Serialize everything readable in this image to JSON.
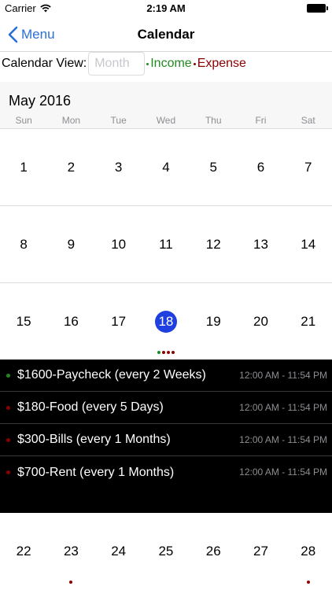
{
  "status_bar": {
    "carrier": "Carrier",
    "time": "2:19 AM"
  },
  "nav": {
    "back_label": "Menu",
    "title": "Calendar"
  },
  "view_row": {
    "label": "Calendar View:",
    "input_value": "",
    "input_placeholder": "Month",
    "income_label": "Income",
    "expense_label": "Expense"
  },
  "colors": {
    "accent": "#2a6fd6",
    "selected": "#1f3fe0",
    "income": "#1f8a1f",
    "expense": "#8b0000"
  },
  "calendar": {
    "month_title": "May 2016",
    "weekdays": [
      "Sun",
      "Mon",
      "Tue",
      "Wed",
      "Thu",
      "Fri",
      "Sat"
    ],
    "weeks": [
      [
        {
          "n": "1"
        },
        {
          "n": "2"
        },
        {
          "n": "3"
        },
        {
          "n": "4"
        },
        {
          "n": "5"
        },
        {
          "n": "6"
        },
        {
          "n": "7"
        }
      ],
      [
        {
          "n": "8"
        },
        {
          "n": "9"
        },
        {
          "n": "10"
        },
        {
          "n": "11"
        },
        {
          "n": "12"
        },
        {
          "n": "13"
        },
        {
          "n": "14"
        }
      ],
      [
        {
          "n": "15"
        },
        {
          "n": "16"
        },
        {
          "n": "17"
        },
        {
          "n": "18",
          "selected": true,
          "dots": [
            "income",
            "expense",
            "expense",
            "expense"
          ]
        },
        {
          "n": "19"
        },
        {
          "n": "20"
        },
        {
          "n": "21"
        }
      ],
      [
        {
          "n": "22"
        },
        {
          "n": "23",
          "dots": [
            "expense"
          ]
        },
        {
          "n": "24"
        },
        {
          "n": "25"
        },
        {
          "n": "26"
        },
        {
          "n": "27"
        },
        {
          "n": "28",
          "dots": [
            "expense"
          ]
        }
      ]
    ]
  },
  "events": [
    {
      "title": "$1600-Paycheck (every 2 Weeks)",
      "time": "12:00 AM - 11:54 PM",
      "kind": "income"
    },
    {
      "title": "$180-Food (every 5 Days)",
      "time": "12:00 AM - 11:54 PM",
      "kind": "expense"
    },
    {
      "title": "$300-Bills (every 1 Months)",
      "time": "12:00 AM - 11:54 PM",
      "kind": "expense"
    },
    {
      "title": "$700-Rent (every 1 Months)",
      "time": "12:00 AM - 11:54 PM",
      "kind": "expense"
    }
  ]
}
